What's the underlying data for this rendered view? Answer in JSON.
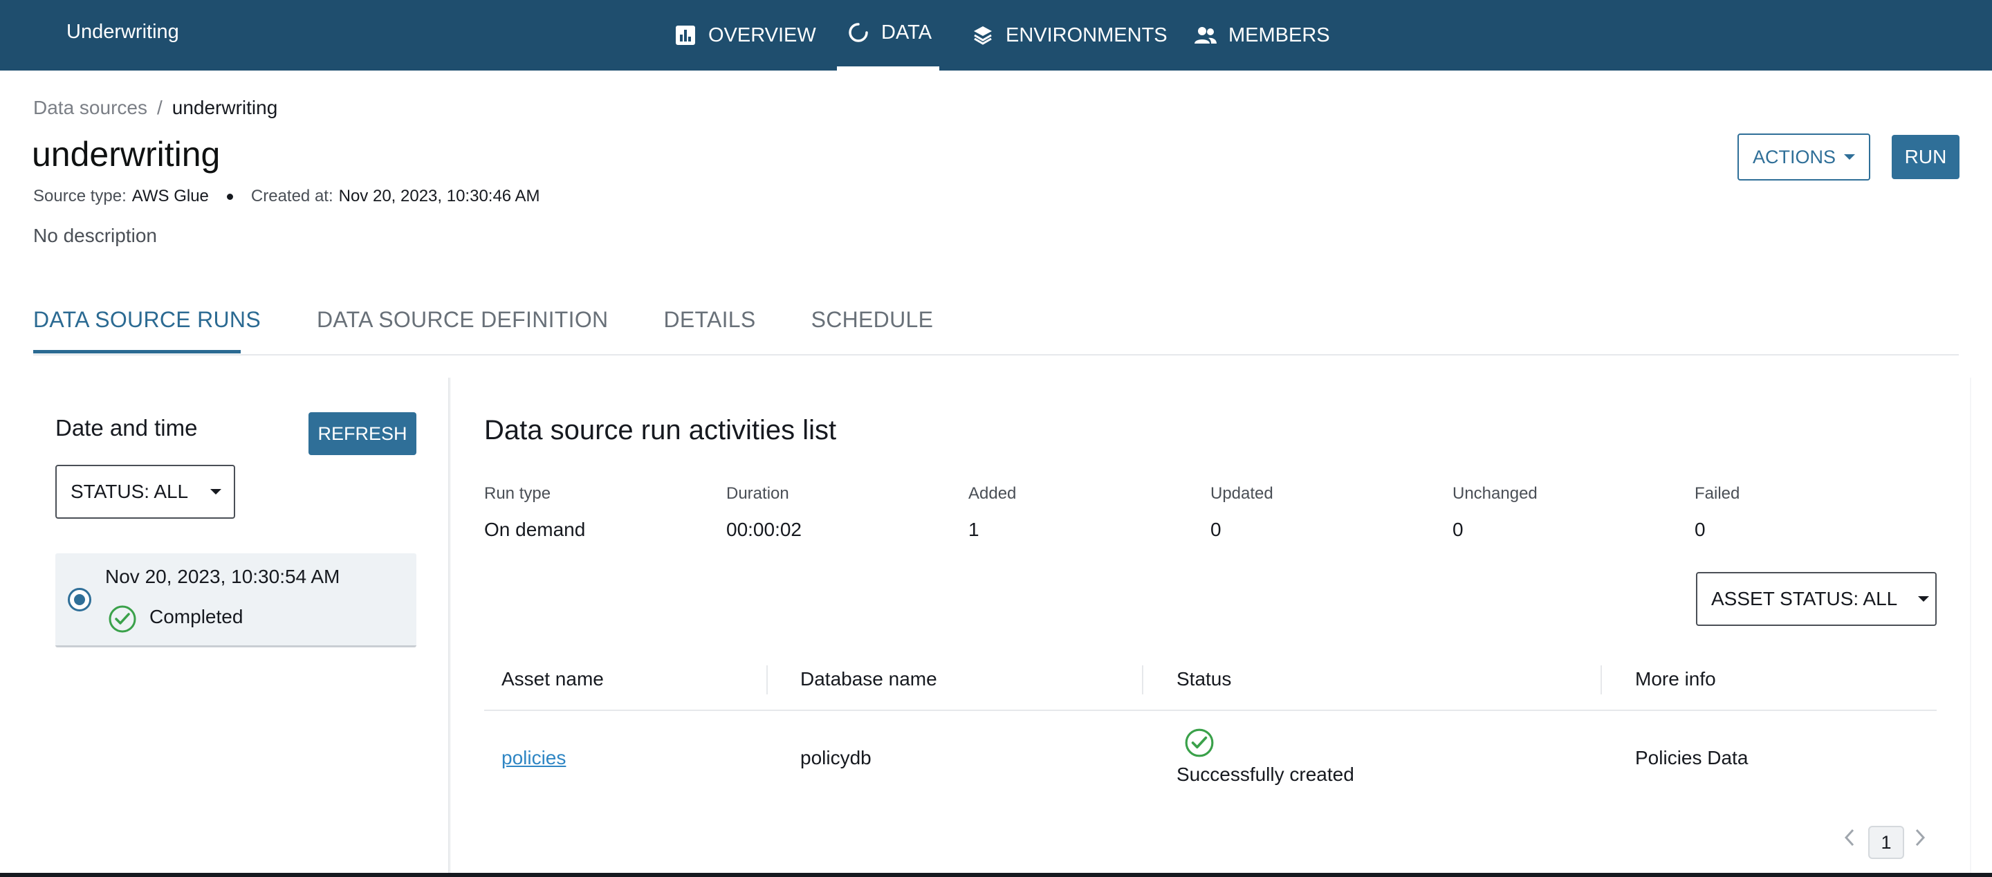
{
  "app": {
    "title": "Underwriting"
  },
  "nav": [
    {
      "label": "OVERVIEW",
      "icon": "bar-chart-icon"
    },
    {
      "label": "DATA",
      "icon": "refresh-circle-icon",
      "active": true
    },
    {
      "label": "ENVIRONMENTS",
      "icon": "layers-icon"
    },
    {
      "label": "MEMBERS",
      "icon": "people-icon"
    }
  ],
  "breadcrumb": {
    "parent": "Data sources",
    "separator": "/",
    "current": "underwriting"
  },
  "header": {
    "title": "underwriting",
    "source_type_label": "Source type:",
    "source_type_value": "AWS Glue",
    "created_label": "Created at:",
    "created_value": "Nov 20, 2023, 10:30:46 AM",
    "description": "No description",
    "actions_label": "ACTIONS",
    "run_label": "RUN"
  },
  "tabs": [
    {
      "label": "DATA SOURCE RUNS",
      "active": true
    },
    {
      "label": "DATA SOURCE DEFINITION"
    },
    {
      "label": "DETAILS"
    },
    {
      "label": "SCHEDULE"
    }
  ],
  "left_panel": {
    "title": "Date and time",
    "refresh_label": "REFRESH",
    "status_filter": "STATUS: ALL",
    "runs": [
      {
        "date": "Nov 20, 2023, 10:30:54 AM",
        "status": "Completed",
        "selected": true
      }
    ]
  },
  "right_panel": {
    "title": "Data source run activities list",
    "stats": [
      {
        "label": "Run type",
        "value": "On demand"
      },
      {
        "label": "Duration",
        "value": "00:00:02"
      },
      {
        "label": "Added",
        "value": "1"
      },
      {
        "label": "Updated",
        "value": "0"
      },
      {
        "label": "Unchanged",
        "value": "0"
      },
      {
        "label": "Failed",
        "value": "0"
      }
    ],
    "asset_status_filter": "ASSET STATUS: ALL",
    "table": {
      "columns": [
        "Asset name",
        "Database name",
        "Status",
        "More info"
      ],
      "rows": [
        {
          "asset_name": "policies",
          "database_name": "policydb",
          "status": "Successfully created",
          "more_info": "Policies Data"
        }
      ]
    },
    "pagination": {
      "current_page": "1"
    }
  },
  "colors": {
    "nav_bg": "#1f4e6e",
    "primary": "#2f6f98",
    "success": "#3aa14a",
    "link": "#2f86c4"
  }
}
